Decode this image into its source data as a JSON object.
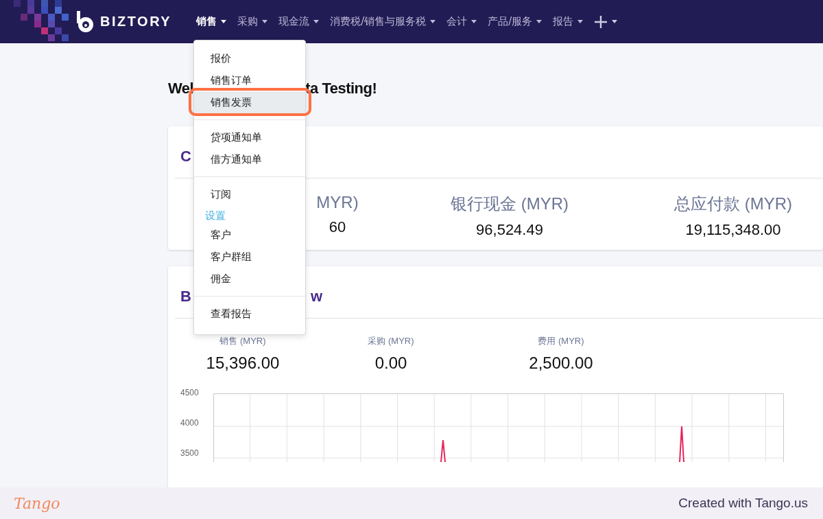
{
  "navbar": {
    "logo": "BIZTORY",
    "items": [
      {
        "label": "销售",
        "selected": true
      },
      {
        "label": "采购",
        "selected": false
      },
      {
        "label": "现金流",
        "selected": false
      },
      {
        "label": "消费税/销售与服务税",
        "selected": false
      },
      {
        "label": "会计",
        "selected": false
      },
      {
        "label": "产品/服务",
        "selected": false
      },
      {
        "label": "报告",
        "selected": false
      }
    ]
  },
  "welcome": [
    "Wel",
    "ta Testing!"
  ],
  "cash_card": {
    "title": "C",
    "stats": [
      {
        "label": "MYR)",
        "value": "60"
      },
      {
        "label": "银行现金 (MYR)",
        "value": "96,524.49"
      },
      {
        "label": "总应付款 (MYR)",
        "value": "19,115,348.00"
      }
    ]
  },
  "business_card": {
    "title": [
      "B",
      "w"
    ],
    "stats": [
      {
        "label": "销售 (MYR)",
        "value": "15,396.00"
      },
      {
        "label": "采购 (MYR)",
        "value": "0.00"
      },
      {
        "label": "费用 (MYR)",
        "value": "2,500.00"
      }
    ],
    "chart": {
      "y_labels": [
        "4500",
        "4000",
        "3500"
      ]
    }
  },
  "dropdown": {
    "sections": [
      [
        {
          "kind": "item",
          "label": "报价",
          "selected": false
        },
        {
          "kind": "item",
          "label": "销售订单",
          "selected": false
        },
        {
          "kind": "item",
          "label": "销售发票",
          "selected": true,
          "highlighted": true
        }
      ],
      [
        {
          "kind": "item",
          "label": "贷项通知单",
          "selected": false
        },
        {
          "kind": "item",
          "label": "借方通知单",
          "selected": false
        }
      ],
      [
        {
          "kind": "item",
          "label": "订阅",
          "selected": false
        },
        {
          "kind": "header",
          "label": "设置"
        },
        {
          "kind": "item",
          "label": "客户",
          "selected": false
        },
        {
          "kind": "item",
          "label": "客户群组",
          "selected": false
        },
        {
          "kind": "item",
          "label": "佣金",
          "selected": false
        }
      ],
      [
        {
          "kind": "item",
          "label": "查看报告",
          "selected": false
        }
      ]
    ]
  },
  "footer": {
    "logo": "Tango",
    "credit": "Created with Tango.us"
  }
}
